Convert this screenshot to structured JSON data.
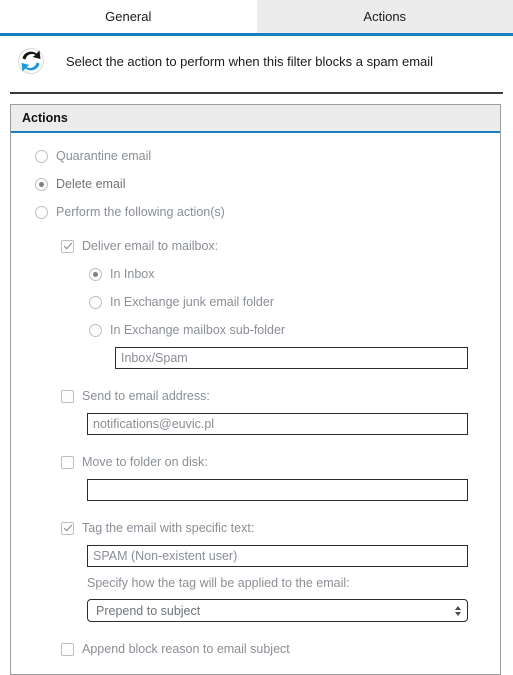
{
  "tabs": [
    {
      "label": "General",
      "active": true
    },
    {
      "label": "Actions",
      "active": false
    }
  ],
  "header": {
    "icon": "sync-arrows-icon",
    "text": "Select the action to perform when this filter blocks a spam email"
  },
  "panel": {
    "title": "Actions",
    "top_radio_group": [
      {
        "label": "Quarantine email",
        "selected": false
      },
      {
        "label": "Delete email",
        "selected": true
      },
      {
        "label": "Perform the following action(s)",
        "selected": false
      }
    ],
    "deliver": {
      "checkbox_label": "Deliver email to mailbox:",
      "checked": true,
      "options": [
        {
          "label": "In Inbox",
          "selected": true
        },
        {
          "label": "In Exchange junk email folder",
          "selected": false
        },
        {
          "label": "In Exchange mailbox sub-folder",
          "selected": false
        }
      ],
      "subfolder_value": "Inbox/Spam"
    },
    "send_email": {
      "checkbox_label": "Send to email address:",
      "checked": false,
      "value": "notifications@euvic.pl"
    },
    "move_folder": {
      "checkbox_label": "Move to folder on disk:",
      "checked": false,
      "value": ""
    },
    "tag_email": {
      "checkbox_label": "Tag the email with specific text:",
      "checked": true,
      "value": "SPAM (Non-existent user)",
      "apply_label": "Specify how the tag will be applied to the email:",
      "apply_value": "Prepend to subject"
    },
    "append_reason": {
      "checkbox_label": "Append block reason to email subject",
      "checked": false
    }
  },
  "colors": {
    "accent": "#1a7fc1",
    "tab_inactive_bg": "#ececec",
    "panel_border": "#9d9d9d",
    "disabled_text": "#8a8f95"
  }
}
